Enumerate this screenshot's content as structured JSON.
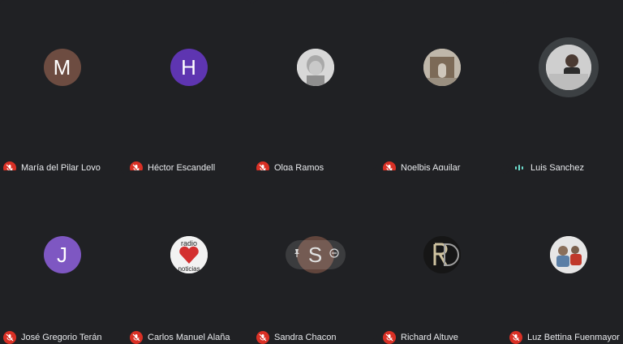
{
  "participants": [
    {
      "name": "María del Pilar Loyo",
      "initial": "M",
      "avatar_color": "#6d4c41",
      "muted": true
    },
    {
      "name": "Héctor Escandell",
      "initial": "H",
      "avatar_color": "#5e35b1",
      "muted": true
    },
    {
      "name": "Olga Ramos",
      "initial": "",
      "avatar_color": "#e6e6e6",
      "muted": true
    },
    {
      "name": "Noelbis Aguilar",
      "initial": "",
      "avatar_color": "#c7c2b8",
      "muted": true
    },
    {
      "name": "Luis Sanchez",
      "initial": "",
      "avatar_color": "#d5d5d5",
      "muted": false,
      "speaking": true
    },
    {
      "name": "José Gregorio Terán",
      "initial": "J",
      "avatar_color": "#7e57c2",
      "muted": true
    },
    {
      "name": "Carlos Manuel Alaña",
      "initial": "",
      "avatar_color": "#f2f2f2",
      "muted": true
    },
    {
      "name": "Sandra Chacon",
      "initial": "S",
      "avatar_color": "#6d4c41",
      "muted": true,
      "hover": true
    },
    {
      "name": "Richard Altuve",
      "initial": "",
      "avatar_color": "#1b1b1b",
      "muted": true
    },
    {
      "name": "Luz Bettina Fuenmayor",
      "initial": "",
      "avatar_color": "#e0e0e0",
      "muted": true
    }
  ],
  "colors": {
    "background": "#202124",
    "mic_off": "#d93025",
    "speaking_bar": "#6fe0d0"
  },
  "icons": {
    "muted": "mic-off-icon",
    "speaking": "audio-wave-icon",
    "hover_actions": [
      "pin-icon",
      "remove-icon"
    ]
  },
  "logo_text": {
    "carlos_avatar": "radio noticias"
  }
}
